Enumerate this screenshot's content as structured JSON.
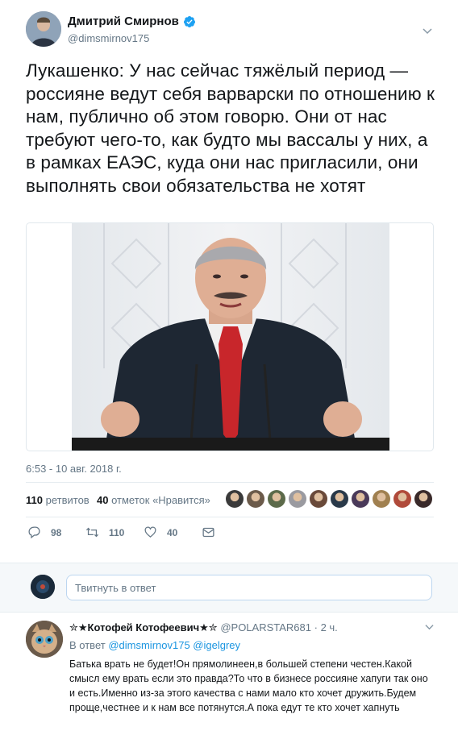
{
  "tweet": {
    "author_name": "Дмитрий Смирнов",
    "author_handle": "@dimsmirnov175",
    "text": "Лукашенко: У нас сейчас тяжёлый период — россияне ведут себя варварски по отношению к нам, публично об этом говорю. Они от нас требуют чего-то, как будто мы вассалы у них, а в рамках ЕАЭС, куда они нас пригласили, они выполнять свои обязательства не хотят",
    "timestamp": "6:53 - 10 авг. 2018 г."
  },
  "stats": {
    "retweets_count": "110",
    "retweets_label": "ретвитов",
    "likes_count": "40",
    "likes_label": "отметок «Нравится»"
  },
  "likers": [
    "#3a3a3a",
    "#6b5a4a",
    "#5c6a4a",
    "#9a9aa0",
    "#6a4a3a",
    "#2a3a4a",
    "#4a3a5a",
    "#a08050",
    "#b04a3a",
    "#3a2a2a"
  ],
  "actions": {
    "reply_count": "98",
    "retweet_count": "110",
    "like_count": "40"
  },
  "reply_box": {
    "placeholder": "Твитнуть в ответ"
  },
  "reply": {
    "name": "✮★Котофей Котофеевич★✮",
    "handle": "@POLARSTAR681",
    "time": "· 2 ч.",
    "reply_to_label": "В ответ",
    "reply_to_user1": "@dimsmirnov175",
    "reply_to_user2": "@igelgrey",
    "text": "Батька врать не будет!Он прямолинеен,в большей степени честен.Какой смысл ему врать если это правда?То что в бизнесе россияне хапуги так оно и есть.Именно из-за этого качества с нами мало кто хочет дружить.Будем проще,честнее и к нам все потянутся.А пока едут те кто хочет хапнуть"
  },
  "colors": {
    "accent": "#1b95e0",
    "muted": "#657786",
    "text": "#14171a"
  }
}
